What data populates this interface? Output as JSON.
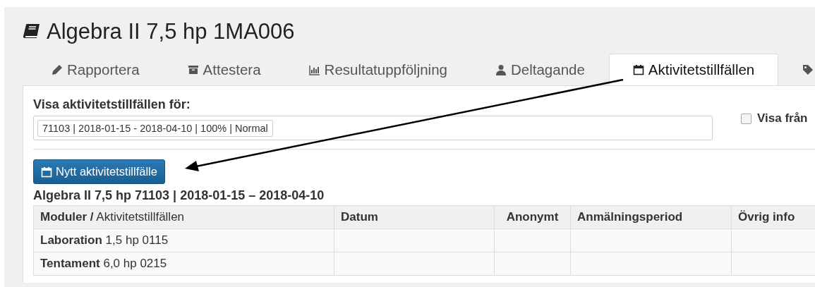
{
  "course_title": "Algebra II 7,5 hp 1MA006",
  "tabs": [
    {
      "label": "Rapportera",
      "selected": false
    },
    {
      "label": "Attestera",
      "selected": false
    },
    {
      "label": "Resultatuppföljning",
      "selected": false
    },
    {
      "label": "Deltagande",
      "selected": false
    },
    {
      "label": "Aktivitetstillfällen",
      "selected": true
    },
    {
      "selected": false
    }
  ],
  "filter": {
    "label": "Visa aktivitetstillfällen för:",
    "chips": [
      "71103 | 2018-01-15 - 2018-04-10 | 100% | Normal"
    ],
    "checkbox": {
      "label": "Visa från",
      "checked": false
    }
  },
  "new_button": "Nytt aktivitetstillfälle",
  "section_heading": "Algebra II 7,5 hp 71103 | 2018-01-15 – 2018-04-10",
  "table": {
    "columns": [
      "**Moduler /** Aktivitetstillfällen",
      "Datum",
      "Anonymt",
      "Anmälningsperiod",
      "Övrig info"
    ],
    "rows": [
      [
        "**Laboration** 1,5 hp 0115",
        "",
        "",
        "",
        ""
      ],
      [
        "**Tentament** 6,0 hp 0215",
        "",
        "",
        "",
        ""
      ]
    ]
  }
}
